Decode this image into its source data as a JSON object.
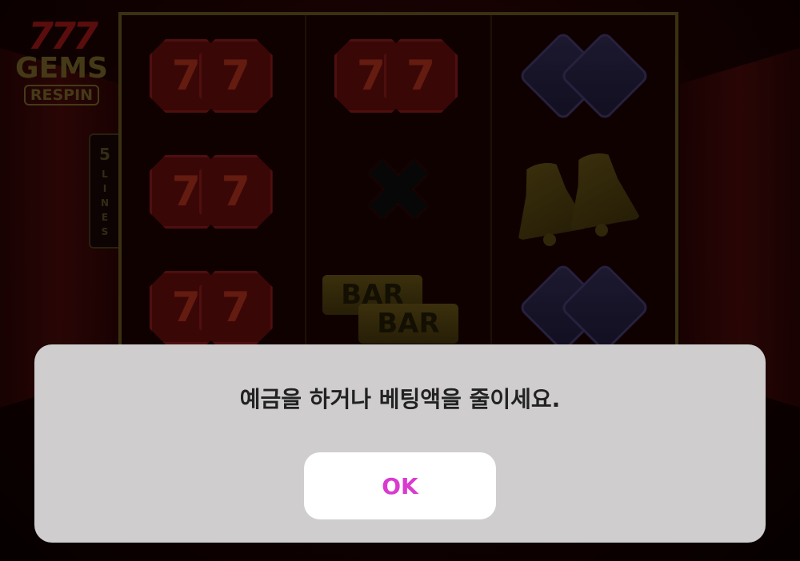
{
  "game": {
    "logo": {
      "line1": "777",
      "line2": "GEMS",
      "line3": "RESPIN"
    },
    "paylines": {
      "count": "5",
      "label": "LINES"
    },
    "reels": [
      [
        "gem-seven",
        "gem-seven",
        "gem-seven"
      ],
      [
        "gem-seven",
        "x",
        "bar"
      ],
      [
        "diamond",
        "bell",
        "diamond"
      ]
    ],
    "symbols": {
      "bar_label": "BAR",
      "seven_glyph": "7",
      "x_glyph": "✖"
    }
  },
  "dialog": {
    "message": "예금을 하거나 베팅액을 줄이세요.",
    "ok_label": "OK"
  },
  "colors": {
    "dialog_bg": "#cfcdcd",
    "ok_text": "#d93bd0",
    "frame_gold": "#5a4c1c"
  }
}
